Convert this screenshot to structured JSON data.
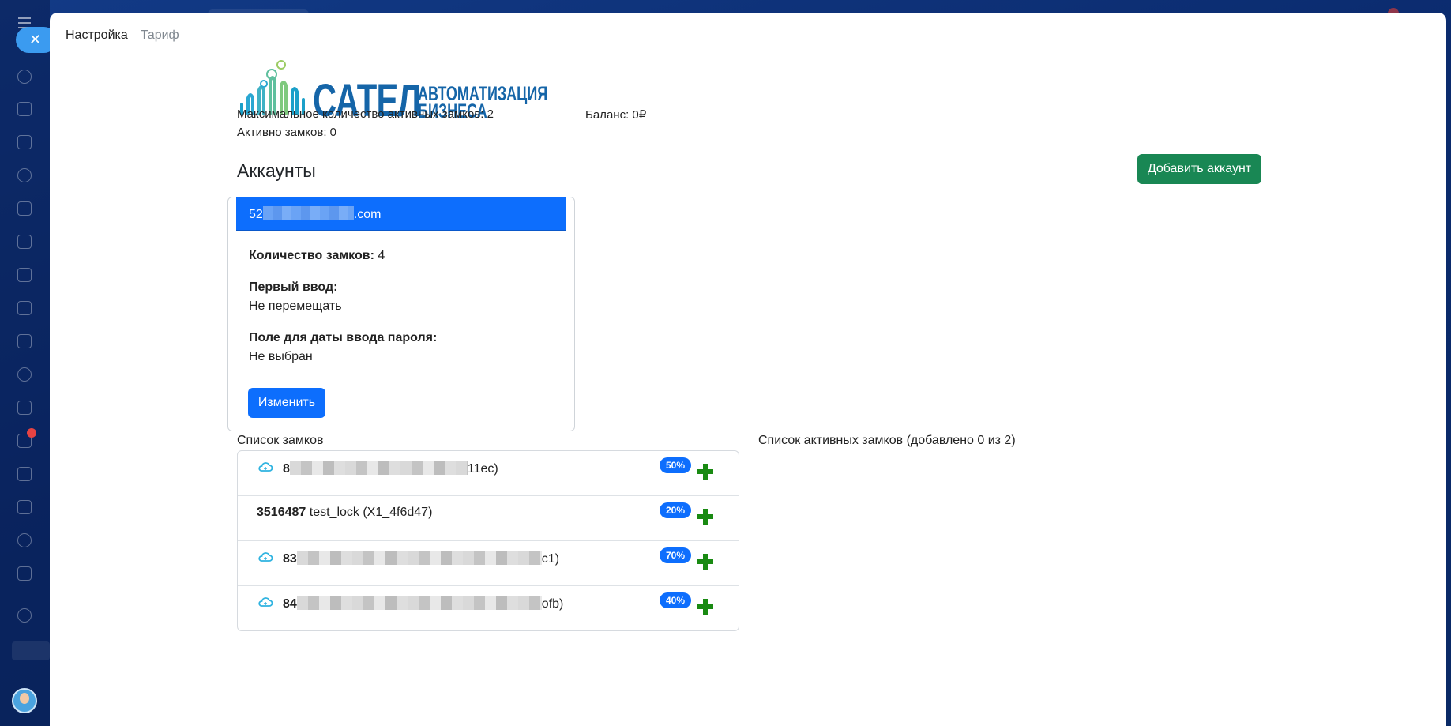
{
  "tabs": [
    {
      "label": "Настройка"
    },
    {
      "label": "Тариф"
    }
  ],
  "logo": {
    "main": "САТЕЛ",
    "sub_line1": "АВТОМАТИЗАЦИЯ",
    "sub_line2": "БИЗНЕСА"
  },
  "summary": {
    "max_active": "Максимальное количество активных замков: 2",
    "balance": "Баланс: 0₽",
    "active": "Активно замков: 0"
  },
  "accounts": {
    "title": "Аккаунты",
    "add_button": "Добавить аккаунт",
    "card": {
      "email_prefix": "52",
      "email_suffix": ".com",
      "locks_count_label": "Количество замков:",
      "locks_count_value": "4",
      "first_input_label": "Первый ввод:",
      "first_input_value": "Не перемещать",
      "password_date_label": "Поле для даты ввода пароля:",
      "password_date_value": "Не выбран",
      "edit_button": "Изменить"
    }
  },
  "locks_list": {
    "title": "Список замков",
    "rows": [
      {
        "id_prefix": "8",
        "name_suffix": "11ec)",
        "badge": "50%",
        "cloud": true
      },
      {
        "id": "3516487",
        "name": "test_lock (X1_4f6d47)",
        "badge": "20%",
        "cloud": false
      },
      {
        "id_prefix": "83",
        "name_suffix": "c1)",
        "badge": "70%",
        "cloud": true
      },
      {
        "id_prefix": "84",
        "name_suffix": "ofb)",
        "badge": "40%",
        "cloud": true
      }
    ]
  },
  "active_locks": {
    "title": "Список активных замков (добавлено 0 из 2)"
  },
  "colors": {
    "primary": "#0d6efd",
    "success": "#198754",
    "plus": "#198a12",
    "logo": "#1565a8"
  }
}
